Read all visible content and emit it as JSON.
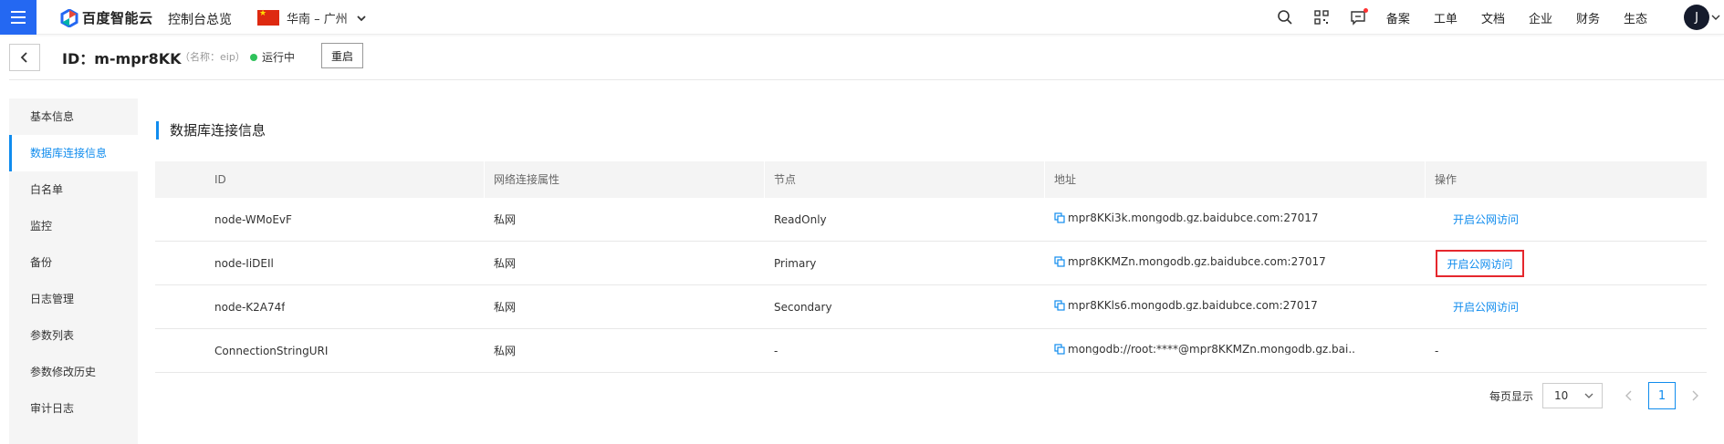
{
  "nav": {
    "logo_text": "百度智能云",
    "console_title": "控制台总览",
    "region": "华南 – 广州",
    "links": [
      "备案",
      "工单",
      "文档",
      "企业",
      "财务",
      "生态"
    ],
    "avatar_letter": "J"
  },
  "header": {
    "instance_id": "ID：m-mpr8KK",
    "instance_name": "（名称：eip）",
    "status": "运行中",
    "restart_label": "重启"
  },
  "sidebar": {
    "items": [
      {
        "label": "基本信息",
        "active": false
      },
      {
        "label": "数据库连接信息",
        "active": true
      },
      {
        "label": "白名单",
        "active": false
      },
      {
        "label": "监控",
        "active": false
      },
      {
        "label": "备份",
        "active": false
      },
      {
        "label": "日志管理",
        "active": false
      },
      {
        "label": "参数列表",
        "active": false
      },
      {
        "label": "参数修改历史",
        "active": false
      },
      {
        "label": "审计日志",
        "active": false
      }
    ]
  },
  "section": {
    "title": "数据库连接信息"
  },
  "table": {
    "headers": [
      "ID",
      "网络连接属性",
      "节点",
      "地址",
      "操作"
    ],
    "rows": [
      {
        "id": "node-WMoEvF",
        "network": "私网",
        "node": "ReadOnly",
        "address": "mpr8KKi3k.mongodb.gz.baidubce.com:27017",
        "op": "开启公网访问"
      },
      {
        "id": "node-IiDEIl",
        "network": "私网",
        "node": "Primary",
        "address": "mpr8KKMZn.mongodb.gz.baidubce.com:27017",
        "op": "开启公网访问"
      },
      {
        "id": "node-K2A74f",
        "network": "私网",
        "node": "Secondary",
        "address": "mpr8KKls6.mongodb.gz.baidubce.com:27017",
        "op": "开启公网访问"
      },
      {
        "id": "ConnectionStringURI",
        "network": "私网",
        "node": "-",
        "address": "mongodb://root:****@mpr8KKMZn.mongodb.gz.bai...",
        "op": "-"
      }
    ]
  },
  "pager": {
    "label": "每页显示",
    "page_size": "10",
    "current_page": "1"
  },
  "colors": {
    "accent": "#108cee",
    "brand": "#2468f2",
    "status_green": "#2fc25b",
    "highlight_red": "#e5272d"
  }
}
